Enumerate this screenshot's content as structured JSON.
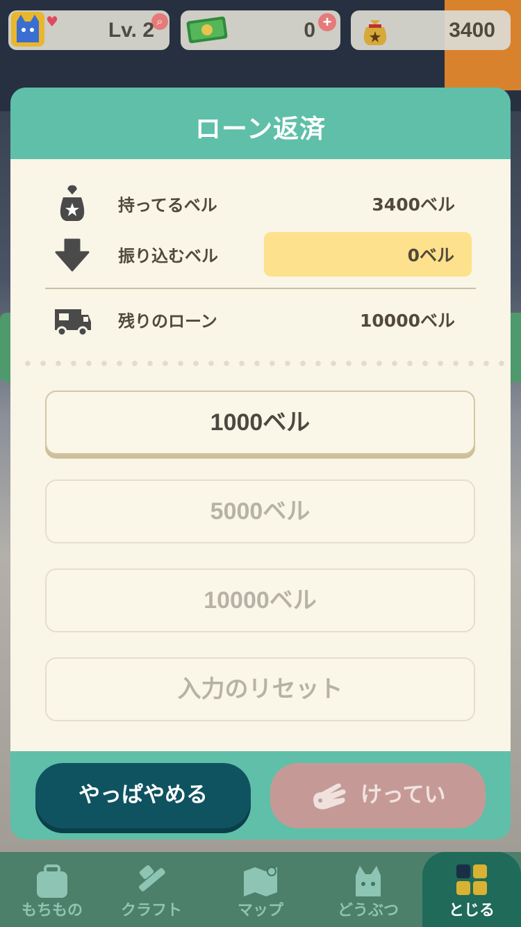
{
  "status_bar": {
    "level": "Lv. 2",
    "tickets": "0",
    "bells": "3400",
    "icons": [
      "cat-avatar-icon",
      "heart-icon",
      "zoom-icon",
      "ticket-icon",
      "plus-icon",
      "bell-bag-icon"
    ]
  },
  "modal": {
    "title": "ローン返済",
    "rows": {
      "held": {
        "label": "持ってるベル",
        "value": "3400ベル",
        "icon": "money-bag-icon"
      },
      "payment": {
        "label": "振り込むベル",
        "value": "0ベル",
        "icon": "down-arrow-icon"
      },
      "remaining": {
        "label": "残りのローン",
        "value": "10000ベル",
        "icon": "camper-van-icon"
      }
    },
    "amount_buttons": [
      "1000ベル",
      "5000ベル",
      "10000ベル"
    ],
    "reset_label": "入力のリセット",
    "cancel_label": "やっぱやめる",
    "confirm_label": "けってい"
  },
  "bottom_nav": {
    "items": [
      "もちもの",
      "クラフト",
      "マップ",
      "どうぶつ",
      "とじる"
    ]
  },
  "colors": {
    "header_teal": "#5fbfa9",
    "panel_cream": "#f9f5e7",
    "input_yellow": "#fde18c",
    "cancel_dark_teal": "#0f5360",
    "confirm_disabled_pink": "#c59a96"
  }
}
